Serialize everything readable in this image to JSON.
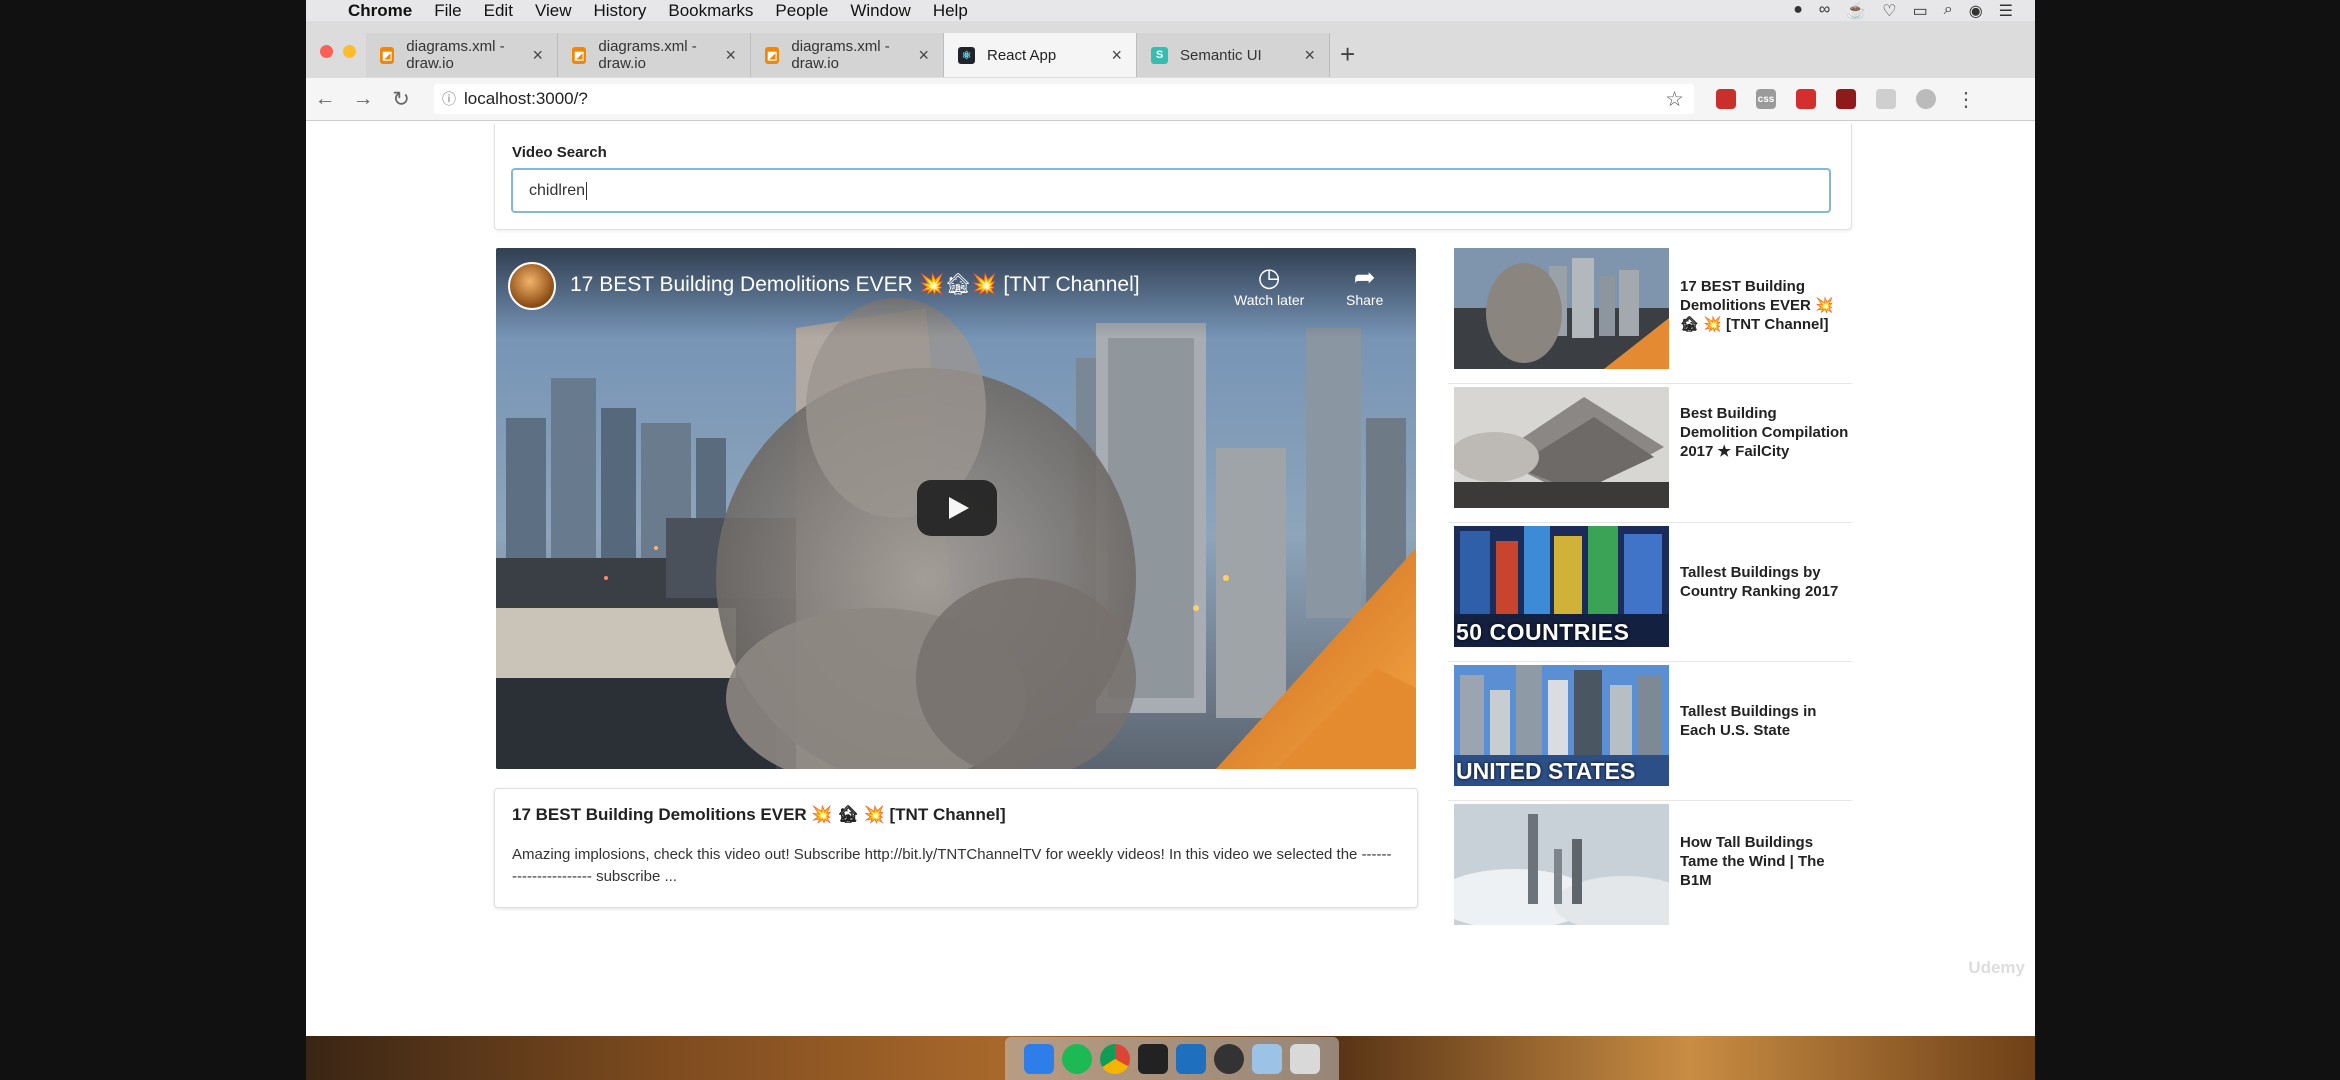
{
  "mac_menubar": {
    "app_name": "Chrome",
    "items": [
      "File",
      "Edit",
      "View",
      "History",
      "Bookmarks",
      "People",
      "Window",
      "Help"
    ]
  },
  "browser": {
    "tabs": [
      {
        "title": "diagrams.xml - draw.io",
        "favicon_color": "#f08705"
      },
      {
        "title": "diagrams.xml - draw.io",
        "favicon_color": "#f08705"
      },
      {
        "title": "diagrams.xml - draw.io",
        "favicon_color": "#f08705"
      },
      {
        "title": "React App",
        "favicon_color": "#20232a"
      },
      {
        "title": "Semantic UI",
        "favicon_color": "#35bdb2"
      }
    ],
    "url": "localhost:3000/?",
    "extensions": [
      {
        "name": "ext-red-counter",
        "label": "",
        "color": "#c9302c"
      },
      {
        "name": "css-ext",
        "label": "css",
        "color": "#9a9a9a"
      },
      {
        "name": "ext-red-box",
        "label": "",
        "color": "#d32f2f"
      },
      {
        "name": "ext-red-badge",
        "label": "",
        "color": "#8e1b1b"
      },
      {
        "name": "ext-grey",
        "label": "",
        "color": "#cfcfcf"
      }
    ]
  },
  "search": {
    "label": "Video Search",
    "value": "chidlren"
  },
  "player": {
    "title": "17 BEST Building Demolitions EVER 💥🏚💥 [TNT Channel]",
    "watch_later": "Watch later",
    "share": "Share"
  },
  "detail": {
    "title": "17 BEST Building Demolitions EVER 💥 🏚 💥 [TNT Channel]",
    "description": "Amazing implosions, check this video out! Subscribe http://bit.ly/TNTChannelTV for weekly videos! In this video we selected the ---------------------- subscribe ..."
  },
  "video_list": [
    {
      "title": "17 BEST Building Demolitions EVER 💥 🏚 💥 [TNT Channel]",
      "thumb_text": ""
    },
    {
      "title": "Best Building Demolition Compilation 2017 ★ FailCity",
      "thumb_text": ""
    },
    {
      "title": "Tallest Buildings by Country Ranking 2017",
      "thumb_text": "50 COUNTRIES"
    },
    {
      "title": "Tallest Buildings in Each U.S. State",
      "thumb_text": "UNITED STATES"
    },
    {
      "title": "How Tall Buildings Tame the Wind | The B1M",
      "thumb_text": ""
    }
  ],
  "watermark": "Udemy"
}
